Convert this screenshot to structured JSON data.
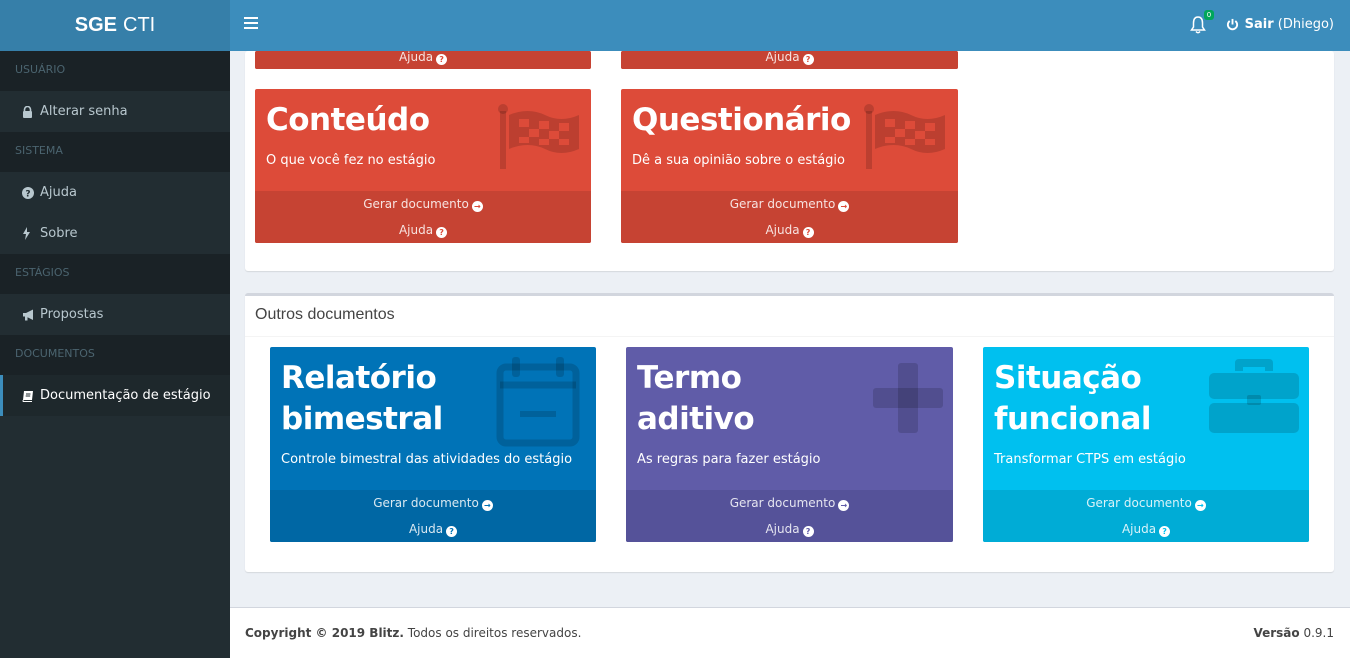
{
  "header": {
    "logo_bold": "SGE",
    "logo_rest": "CTI",
    "notification_count": "0",
    "logout_label": "Sair",
    "user_label": "(Dhiego)"
  },
  "sidebar": {
    "sections": [
      {
        "header": "USUÁRIO",
        "items": [
          {
            "label": "Alterar senha",
            "icon": "lock-icon"
          }
        ]
      },
      {
        "header": "SISTEMA",
        "items": [
          {
            "label": "Ajuda",
            "icon": "question-circle-icon"
          },
          {
            "label": "Sobre",
            "icon": "bolt-icon"
          }
        ]
      },
      {
        "header": "ESTÁGIOS",
        "items": [
          {
            "label": "Propostas",
            "icon": "bullhorn-icon"
          }
        ]
      },
      {
        "header": "DOCUMENTOS",
        "items": [
          {
            "label": "Documentação de estágio",
            "icon": "book-icon",
            "active": true
          }
        ]
      }
    ]
  },
  "top_cards": [
    {
      "help": "Ajuda"
    },
    {
      "help": "Ajuda"
    }
  ],
  "cards_row1": [
    {
      "title": "Conteúdo",
      "subtitle": "O que você fez no estágio",
      "action": "Gerar documento",
      "help": "Ajuda",
      "icon": "flag-checkered-icon",
      "color": "#dd4b39"
    },
    {
      "title": "Questionário",
      "subtitle": "Dê a sua opinião sobre o estágio",
      "action": "Gerar documento",
      "help": "Ajuda",
      "icon": "flag-checkered-icon",
      "color": "#dd4b39"
    }
  ],
  "other_docs": {
    "title": "Outros documentos",
    "cards": [
      {
        "title_line1": "Relatório",
        "title_line2": "bimestral",
        "subtitle": "Controle bimestral das atividades do estágio",
        "action": "Gerar documento",
        "help": "Ajuda",
        "icon": "calendar-minus-icon",
        "color": "#0073b7"
      },
      {
        "title_line1": "Termo",
        "title_line2": "aditivo",
        "subtitle": "As regras para fazer estágio",
        "action": "Gerar documento",
        "help": "Ajuda",
        "icon": "plus-icon",
        "color": "#605ca8"
      },
      {
        "title_line1": "Situação",
        "title_line2": "funcional",
        "subtitle": "Transformar CTPS em estágio",
        "action": "Gerar documento",
        "help": "Ajuda",
        "icon": "briefcase-icon",
        "color": "#00c0ef"
      }
    ]
  },
  "footer": {
    "copyright": "Copyright © 2019 Blitz.",
    "rights": "Todos os direitos reservados.",
    "version_label": "Versão",
    "version": "0.9.1"
  }
}
